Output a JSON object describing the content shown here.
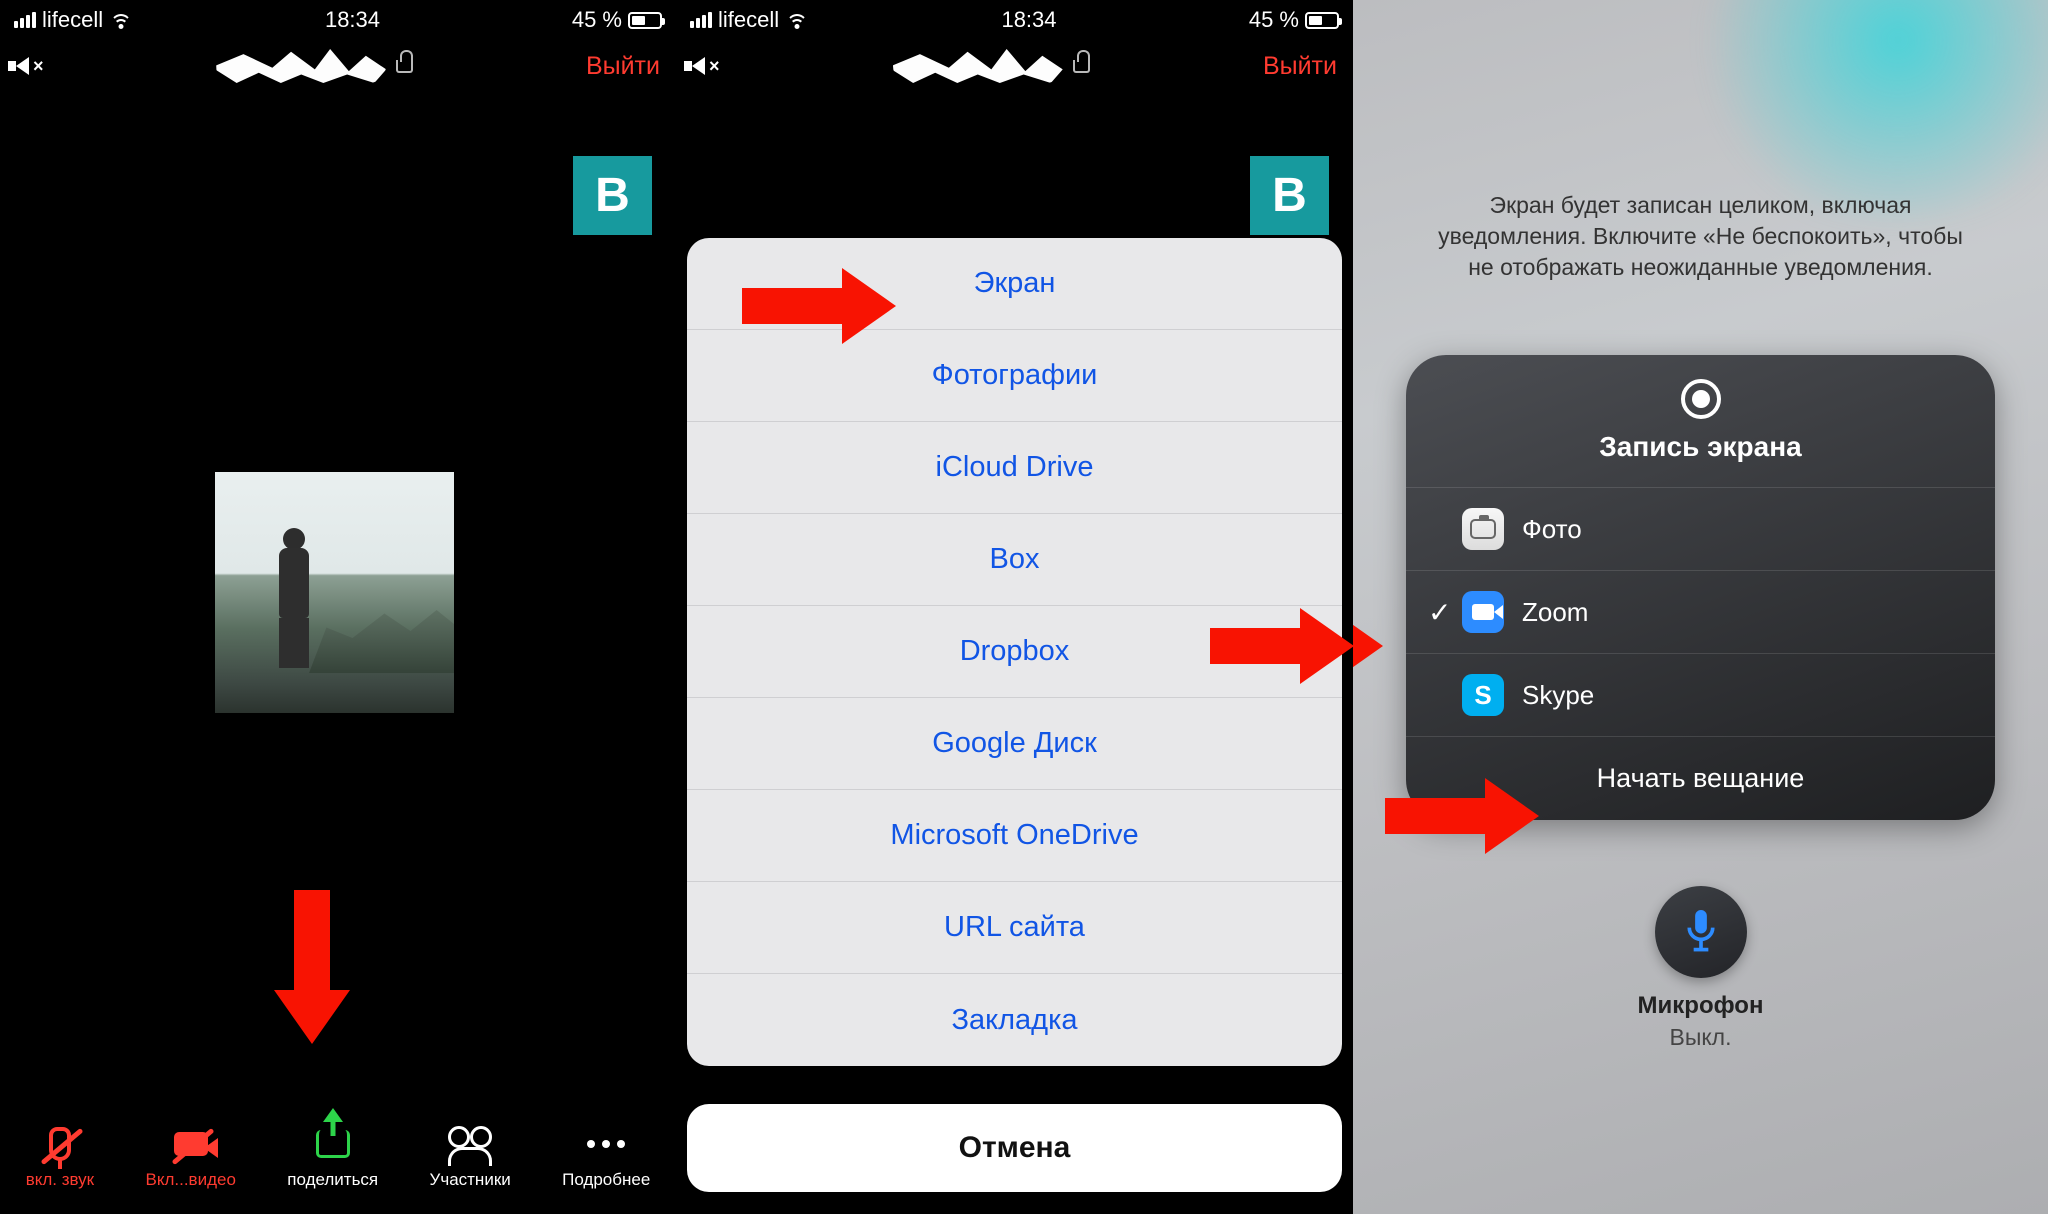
{
  "status": {
    "carrier": "lifecell",
    "time": "18:34",
    "battery_pct": "45 %"
  },
  "zoom_header": {
    "exit": "Выйти",
    "participant_initial": "B"
  },
  "toolbar": {
    "audio": "вкл. звук",
    "video": "Вкл...видео",
    "share": "поделиться",
    "participants": "Участники",
    "more": "Подробнее"
  },
  "share_sheet": {
    "items": [
      "Экран",
      "Фотографии",
      "iCloud Drive",
      "Box",
      "Dropbox",
      "Google Диск",
      "Microsoft OneDrive",
      "URL сайта",
      "Закладка"
    ],
    "cancel": "Отмена"
  },
  "broadcast": {
    "hint": "Экран будет записан целиком, включая уведомления. Включите «Не беспокоить», чтобы не отображать неожиданные уведомления.",
    "title": "Запись экрана",
    "apps": [
      {
        "name": "Фото",
        "selected": false
      },
      {
        "name": "Zoom",
        "selected": true
      },
      {
        "name": "Skype",
        "selected": false
      }
    ],
    "start": "Начать вещание",
    "mic_label": "Микрофон",
    "mic_state": "Выкл."
  }
}
